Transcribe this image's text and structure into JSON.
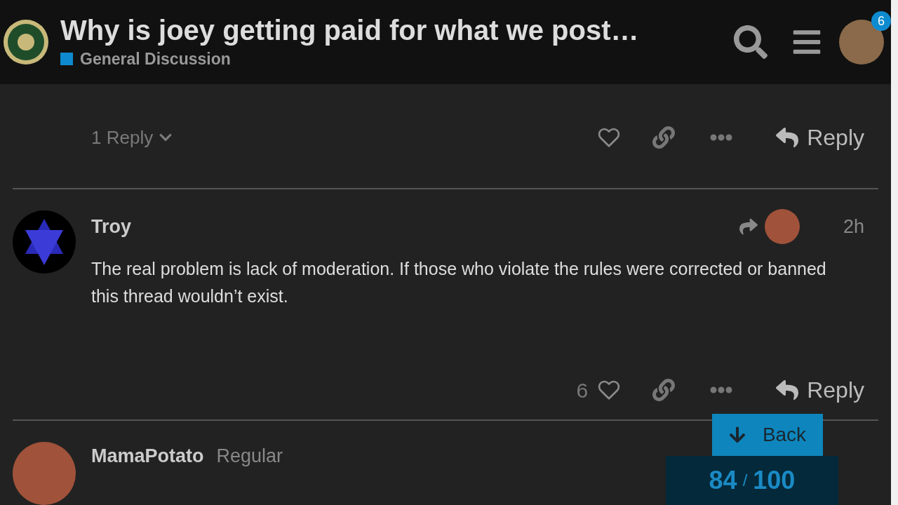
{
  "header": {
    "title": "Why is joey getting paid for what we post…",
    "category": {
      "name": "General Discussion",
      "color": "#0e8bd0"
    },
    "notification_count": "6"
  },
  "previous_post": {
    "replies": "1 Reply",
    "reply_label": "Reply"
  },
  "posts": [
    {
      "kind": "full",
      "author": "Troy",
      "reply_to": true,
      "time": "2h",
      "body": "The real problem is lack of moderation. If those who violate the rules were corrected or banned this thread wouldn’t exist.",
      "like_count": "6",
      "reply_label": "Reply"
    },
    {
      "kind": "partial",
      "author": "MamaPotato",
      "title": "Regular"
    }
  ],
  "back_button": "Back",
  "progress": {
    "current": "84",
    "separator": "/",
    "total": "100"
  }
}
